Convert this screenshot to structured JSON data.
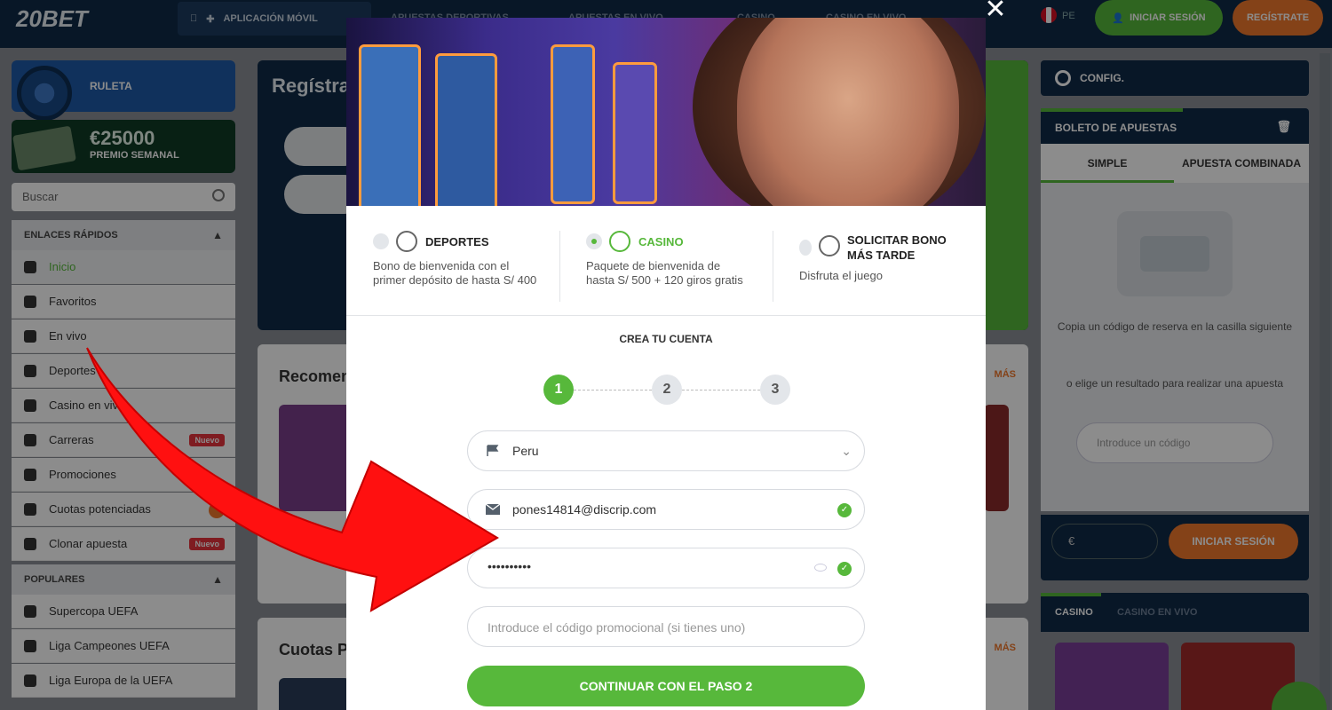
{
  "header": {
    "logo": "20BET",
    "nav_app": "APLICACIÓN MÓVIL",
    "nav_items": [
      "APUESTAS DEPORTIVAS",
      "APUESTAS EN VIVO",
      "CASINO",
      "CASINO EN VIVO"
    ],
    "lang": "PE",
    "login_button": "INICIAR SESIÓN",
    "register_button": "REGÍSTRATE"
  },
  "left_sidebar": {
    "banner_ruleta": "RULETA",
    "banner_premio_amount": "€25000",
    "banner_premio_label": "PREMIO SEMANAL",
    "search_placeholder": "Buscar",
    "quick_links_title": "ENLACES RÁPIDOS",
    "quick_links": [
      {
        "label": "Inicio"
      },
      {
        "label": "Favoritos"
      },
      {
        "label": "En vivo"
      },
      {
        "label": "Deportes"
      },
      {
        "label": "Casino en vivo"
      },
      {
        "label": "Carreras",
        "badge": "Nuevo"
      },
      {
        "label": "Promociones"
      },
      {
        "label": "Cuotas potenciadas"
      },
      {
        "label": "Clonar apuesta",
        "badge": "Nuevo"
      }
    ],
    "popular_title": "POPULARES",
    "popular": [
      {
        "label": "Supercopa UEFA"
      },
      {
        "label": "Liga Campeones UEFA"
      },
      {
        "label": "Liga Europa de la UEFA"
      }
    ]
  },
  "center": {
    "register_title": "Regístra",
    "recommended_title": "Recomen",
    "odds_title": "Cuotas P",
    "more_label": "MÁS"
  },
  "right_sidebar": {
    "config": "CONFIG.",
    "slip_title": "BOLETO DE APUESTAS",
    "tab_simple": "SIMPLE",
    "tab_combo": "APUESTA COMBINADA",
    "text_copy": "Copia un código de reserva en la casilla siguiente",
    "text_choose": "o elige un resultado para realizar una apuesta",
    "code_placeholder": "Introduce un código",
    "currency": "€",
    "slip_login": "INICIAR SESIÓN",
    "casino_tab": "CASINO",
    "casino_live_tab": "CASINO EN VIVO"
  },
  "modal": {
    "bonuses": [
      {
        "title": "DEPORTES",
        "desc": "Bono de bienvenida con el primer depósito de hasta S/ 400",
        "selected": false
      },
      {
        "title": "CASINO",
        "desc": "Paquete de bienvenida de hasta S/ 500 + 120 giros gratis",
        "selected": true
      },
      {
        "title": "SOLICITAR BONO MÁS TARDE",
        "desc": "Disfruta el juego",
        "selected": false
      }
    ],
    "form_title": "CREA TU CUENTA",
    "steps": [
      "1",
      "2",
      "3"
    ],
    "country_value": "Peru",
    "email_value": "pones14814@discrip.com",
    "password_value": "••••••••••",
    "promo_placeholder": "Introduce el código promocional (si tienes uno)",
    "cta_label": "CONTINUAR CON EL PASO 2"
  },
  "colors": {
    "brand_green": "#57b83b",
    "brand_orange": "#f0782c",
    "navy": "#0f2a47",
    "arrow_red": "#ff1010"
  }
}
